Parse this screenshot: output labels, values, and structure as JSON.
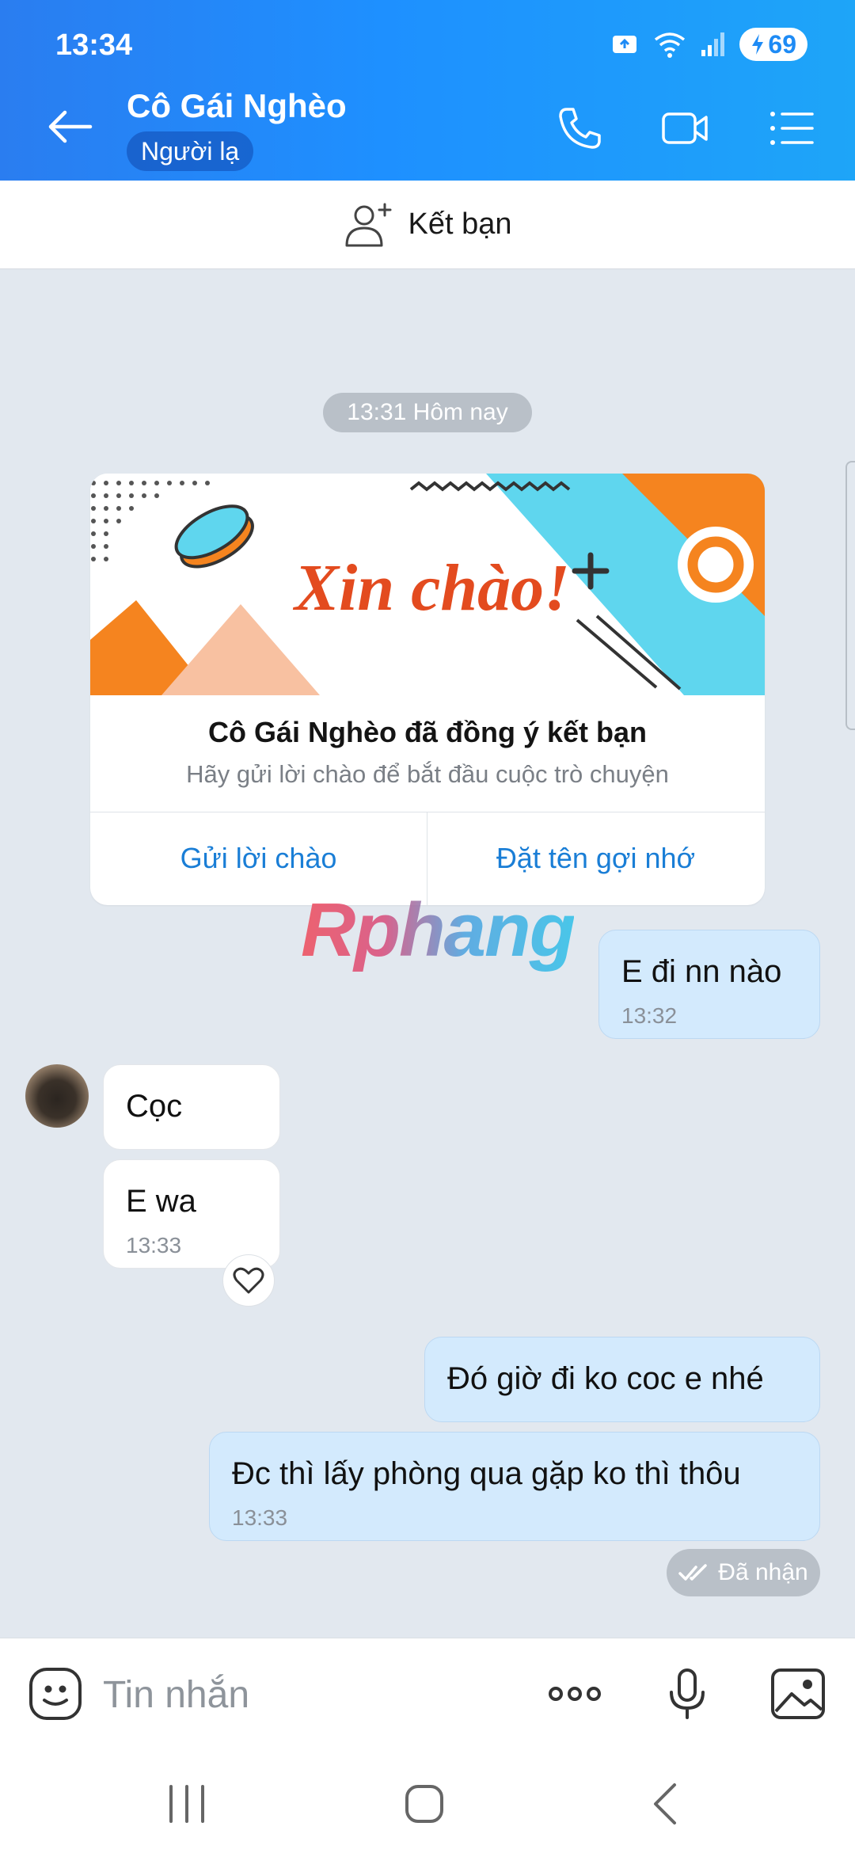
{
  "status_bar": {
    "time": "13:34",
    "battery": "69",
    "icons": [
      "notification-icon",
      "wifi-icon",
      "signal-icon",
      "battery-charging-icon"
    ]
  },
  "header": {
    "contact_name": "Cô Gái Nghèo",
    "badge": "Người lạ",
    "icons": [
      "back-arrow-icon",
      "phone-icon",
      "video-call-icon",
      "menu-list-icon"
    ]
  },
  "add_friend": {
    "label": "Kết bạn",
    "icon": "add-user-icon"
  },
  "conversation": {
    "time_separator": "13:31 Hôm nay",
    "friend_card": {
      "banner_text": "Xin chào!",
      "title": "Cô Gái Nghèo đã đồng ý kết bạn",
      "subtitle": "Hãy gửi lời chào để bắt đầu cuộc trò chuyện",
      "action_left": "Gửi lời chào",
      "action_right": "Đặt tên gợi nhớ"
    },
    "watermark": "Rphang",
    "messages": [
      {
        "side": "sent",
        "text": "E đi nn nào",
        "time": "13:32"
      },
      {
        "side": "received",
        "text": "Cọc",
        "time": ""
      },
      {
        "side": "received",
        "text": "E wa",
        "time": "13:33"
      },
      {
        "side": "sent",
        "text": "Đó giờ đi ko coc e nhé",
        "time": ""
      },
      {
        "side": "sent",
        "text": "Đc thì lấy phòng qua gặp ko thì thôu",
        "time": "13:33"
      }
    ],
    "delivery_status": "Đã nhận"
  },
  "input_bar": {
    "placeholder": "Tin nhắn",
    "icons": [
      "sticker-icon",
      "more-options-icon",
      "microphone-icon",
      "image-icon"
    ]
  },
  "nav_bar": {
    "icons": [
      "recent-apps-icon",
      "home-icon",
      "back-icon"
    ]
  },
  "colors": {
    "header_gradient_start": "#2a7df0",
    "header_gradient_end": "#1ea5f8",
    "sent_bubble": "#d3eafd",
    "received_bubble": "#ffffff",
    "chat_background": "#e2e8ef",
    "link_blue": "#1a7ed6"
  }
}
